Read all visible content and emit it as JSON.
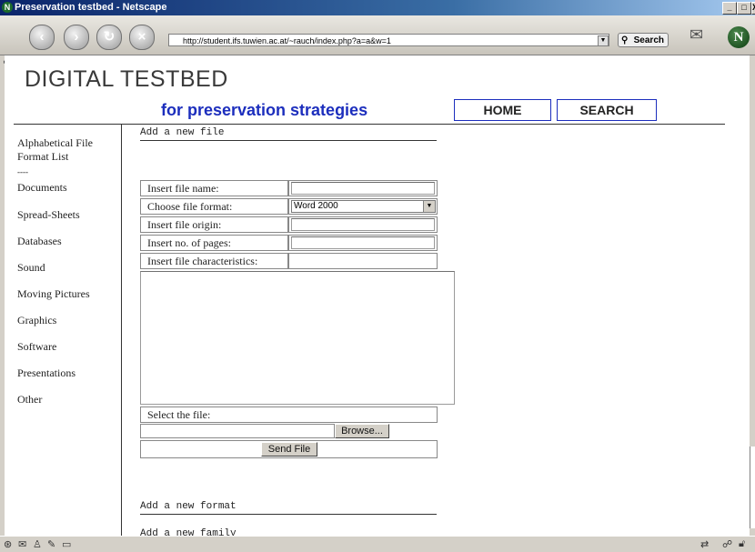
{
  "window": {
    "title": "Preservation testbed - Netscape",
    "minimize": "_",
    "maximize": "□",
    "close": "X"
  },
  "browser": {
    "url": "http://student.ifs.tuwien.ac.at/~rauch/index.php?a=a&w=1",
    "search_label": "Search",
    "netscape_logo": "N"
  },
  "site": {
    "title": "DIGITAL TESTBED",
    "subtitle": "for preservation strategies",
    "nav": [
      "HOME",
      "SEARCH"
    ]
  },
  "sidebar": {
    "items": [
      "Alphabetical File",
      "Format List",
      "----",
      "Documents",
      "Spread-Sheets",
      "Databases",
      "Sound",
      "Moving Pictures",
      "Graphics",
      "Software",
      "Presentations",
      "Other"
    ]
  },
  "main": {
    "section_add_file": "Add a new file",
    "form": {
      "file_name_label": "Insert file name:",
      "file_format_label": "Choose file format:",
      "file_format_value": "Word 2000",
      "file_origin_label": "Insert file origin:",
      "pages_label": "Insert no. of pages:",
      "characteristics_label": "Insert file characteristics:",
      "select_file_label": "Select the file:",
      "browse_button": "Browse...",
      "send_button": "Send File"
    },
    "section_add_format": "Add a new format",
    "section_add_family": "Add a new family"
  },
  "icons": {
    "back": "back-icon",
    "forward": "forward-icon",
    "reload": "reload-icon",
    "stop": "stop-icon",
    "search": "search-icon"
  }
}
